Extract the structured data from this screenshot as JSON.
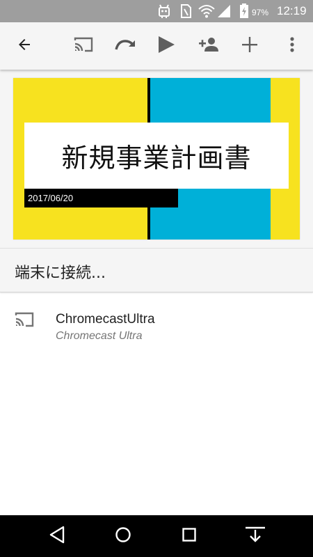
{
  "status_bar": {
    "battery_percent": "97%",
    "time": "12:19",
    "icons": [
      "android-robot-icon",
      "sim-card-icon",
      "wifi-icon",
      "signal-icon",
      "battery-charging-icon"
    ]
  },
  "toolbar": {
    "icons": [
      "back-arrow-icon",
      "cast-icon",
      "redo-icon",
      "play-icon",
      "add-person-icon",
      "plus-icon",
      "more-vert-icon"
    ]
  },
  "slide": {
    "title": "新規事業計画書",
    "date": "2017/06/20",
    "colors": {
      "yellow": "#f7e21f",
      "blue": "#00b0d8",
      "black": "#000000"
    }
  },
  "connect": {
    "title": "端末に接続..."
  },
  "devices": [
    {
      "name": "ChromecastUltra",
      "model": "Chromecast Ultra",
      "icon": "cast-icon"
    }
  ],
  "nav_bar": {
    "icons": [
      "back-triangle-icon",
      "home-circle-icon",
      "recents-square-icon",
      "notification-pulldown-icon"
    ]
  }
}
